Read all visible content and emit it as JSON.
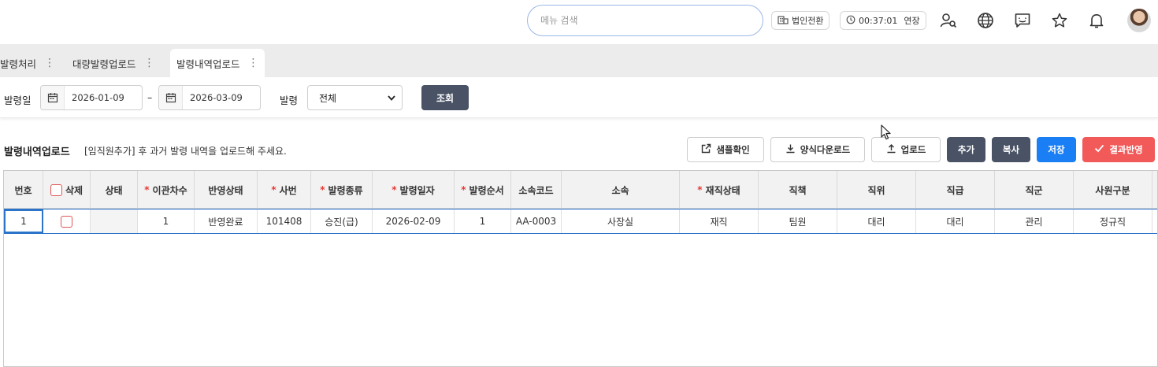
{
  "topbar": {
    "search_placeholder": "메뉴 검색",
    "corp_switch": "법인전환",
    "timer": "00:37:01",
    "extend": "연장",
    "icons": [
      "user-search-icon",
      "globe-icon",
      "chat-icon",
      "star-icon",
      "bell-icon"
    ]
  },
  "tabs": [
    {
      "label": "발령처리"
    },
    {
      "label": "대량발령업로드"
    },
    {
      "label": "발령내역업로드"
    }
  ],
  "filter": {
    "date_label": "발령일",
    "date_from": "2026-01-09",
    "date_sep": "–",
    "date_to": "2026-03-09",
    "type_label": "발령",
    "type_value": "전체",
    "query_button": "조회"
  },
  "section": {
    "title": "발령내역업로드",
    "description": "[임직원추가] 후 과거 발령 내역을 업로드해 주세요.",
    "buttons": {
      "sample": "샘플확인",
      "download": "양식다운로드",
      "upload": "업로드",
      "add": "추가",
      "copy": "복사",
      "save": "저장",
      "apply": "결과반영"
    }
  },
  "colors": {
    "dark_button": "#4a5366",
    "save_button": "#1a7ff5",
    "apply_button": "#f25a5a",
    "required_mark": "#e53935",
    "selection_border": "#2b74c9"
  },
  "grid": {
    "columns": [
      {
        "label": "번호",
        "required": false
      },
      {
        "label": "삭제",
        "required": false
      },
      {
        "label": "상태",
        "required": false
      },
      {
        "label": "이관차수",
        "required": true
      },
      {
        "label": "반영상태",
        "required": false
      },
      {
        "label": "사번",
        "required": true
      },
      {
        "label": "발령종류",
        "required": true
      },
      {
        "label": "발령일자",
        "required": true
      },
      {
        "label": "발령순서",
        "required": true
      },
      {
        "label": "소속코드",
        "required": false
      },
      {
        "label": "소속",
        "required": false
      },
      {
        "label": "재직상태",
        "required": true
      },
      {
        "label": "직책",
        "required": false
      },
      {
        "label": "직위",
        "required": false
      },
      {
        "label": "직급",
        "required": false
      },
      {
        "label": "직군",
        "required": false
      },
      {
        "label": "사원구분",
        "required": false
      }
    ],
    "rows": [
      {
        "no": "1",
        "status": "",
        "transfer_no": "1",
        "apply_status": "반영완료",
        "emp_no": "101408",
        "type": "승진(급)",
        "date": "2026-02-09",
        "order": "1",
        "dept_code": "AA-0003",
        "dept": "사장실",
        "emp_status": "재직",
        "duty": "팀원",
        "position": "대리",
        "grade": "대리",
        "job_group": "관리",
        "emp_type": "정규직"
      }
    ]
  }
}
